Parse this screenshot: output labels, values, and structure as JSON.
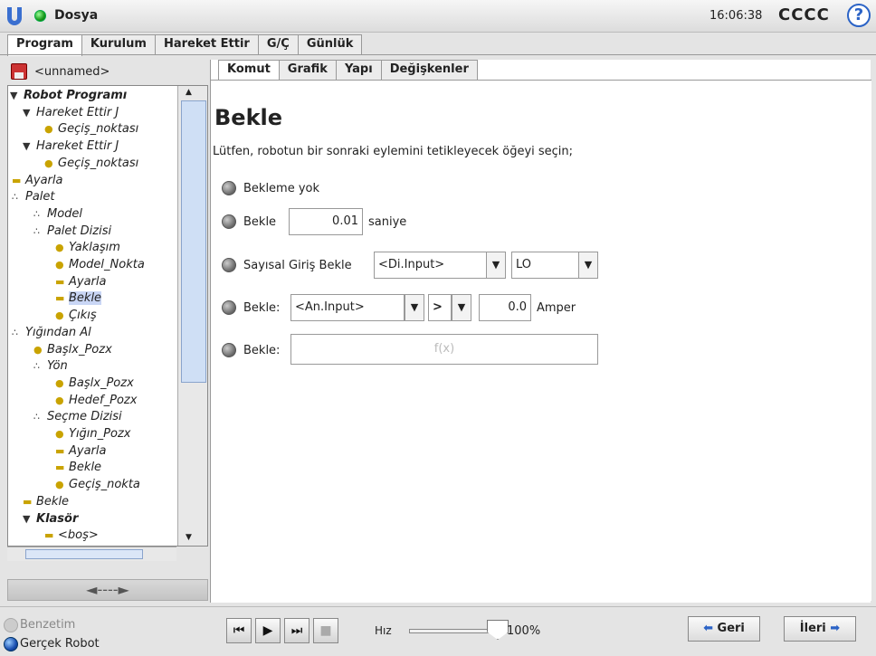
{
  "titlebar": {
    "app_title": "Dosya",
    "time": "16:06:38",
    "robot_name": "CCCC",
    "help_label": "?"
  },
  "main_tabs": [
    {
      "label": "Program"
    },
    {
      "label": "Kurulum"
    },
    {
      "label": "Hareket Ettir"
    },
    {
      "label": "G/Ç"
    },
    {
      "label": "Günlük"
    }
  ],
  "left": {
    "filename": "<unnamed>",
    "nav_arrows": "◄----►"
  },
  "tree": [
    {
      "label": "Robot Programı",
      "icon": "collapse-triangle"
    },
    {
      "label": "Hareket Ettir J",
      "icon": "collapse-triangle"
    },
    {
      "label": "Geçiş_noktası",
      "icon": "waypoint-dot"
    },
    {
      "label": "Hareket Ettir J",
      "icon": "collapse-triangle"
    },
    {
      "label": "Geçiş_noktası",
      "icon": "waypoint-dot"
    },
    {
      "label": "Ayarla",
      "icon": "set-bar"
    },
    {
      "label": "Palet",
      "icon": "pallet-dots"
    },
    {
      "label": "Model",
      "icon": "pallet-dots"
    },
    {
      "label": "Palet Dizisi",
      "icon": "pallet-dots"
    },
    {
      "label": "Yaklaşım",
      "icon": "waypoint-dot"
    },
    {
      "label": "Model_Nokta",
      "icon": "waypoint-dot"
    },
    {
      "label": "Ayarla",
      "icon": "set-bar"
    },
    {
      "label": "Bekle",
      "icon": "set-bar"
    },
    {
      "label": "Çıkış",
      "icon": "waypoint-dot"
    },
    {
      "label": "Yığından Al",
      "icon": "pallet-dots"
    },
    {
      "label": "Başlx_Pozx",
      "icon": "waypoint-dot"
    },
    {
      "label": "Yön",
      "icon": "pallet-dots"
    },
    {
      "label": "Başlx_Pozx",
      "icon": "waypoint-dot"
    },
    {
      "label": "Hedef_Pozx",
      "icon": "waypoint-dot"
    },
    {
      "label": "Seçme Dizisi",
      "icon": "pallet-dots"
    },
    {
      "label": "Yığın_Pozx",
      "icon": "waypoint-dot"
    },
    {
      "label": "Ayarla",
      "icon": "set-bar"
    },
    {
      "label": "Bekle",
      "icon": "set-bar"
    },
    {
      "label": "Geçiş_nokta",
      "icon": "waypoint-dot"
    },
    {
      "label": "Bekle",
      "icon": "set-bar"
    },
    {
      "label": "Klasör",
      "icon": "collapse-triangle"
    },
    {
      "label": "<boş>",
      "icon": "set-bar"
    }
  ],
  "sub_tabs": [
    {
      "label": "Komut"
    },
    {
      "label": "Grafik"
    },
    {
      "label": "Yapı"
    },
    {
      "label": "Değişkenler"
    }
  ],
  "command": {
    "title": "Bekle",
    "instruction": "Lütfen, robotun bir sonraki eylemini tetikleyecek öğeyi seçin;",
    "opt_none": "Bekleme yok",
    "opt_time_label": "Bekle",
    "opt_time_value": "0.01",
    "opt_time_unit": "saniye",
    "opt_digital_label": "Sayısal Giriş Bekle",
    "opt_digital_input": "<Di.Input>",
    "opt_digital_value": "LO",
    "opt_analog_label": "Bekle:",
    "opt_analog_input": "<An.Input>",
    "opt_analog_op": ">",
    "opt_analog_value": "0.0",
    "opt_analog_unit": "Amper",
    "opt_expr_label": "Bekle:",
    "opt_expr_placeholder": "f(x)"
  },
  "bottom": {
    "sim_label": "Benzetim",
    "real_label": "Gerçek Robot",
    "speed_label": "Hız",
    "speed_value": "100%",
    "speed_fraction": 1.0,
    "back_label": "Geri",
    "next_label": "İleri"
  },
  "colors": {
    "accent": "#2b63c6",
    "selection": "#c9d6f5"
  }
}
